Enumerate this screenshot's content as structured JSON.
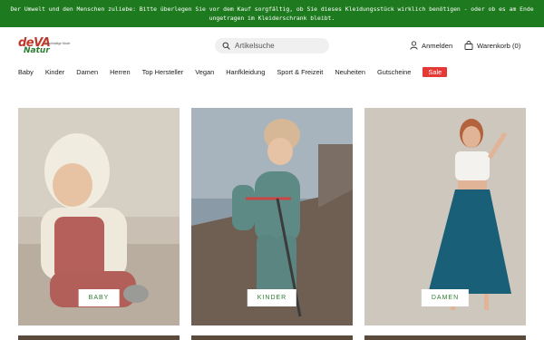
{
  "announcement": {
    "line1": "Der Umwelt und den Menschen zuliebe: Bitte überlegen Sie vor dem Kauf sorgfältig, ob Sie dieses Kleidungsstück wirklich benötigen - oder ob es am Ende",
    "line2": "ungetragen im Kleiderschrank bleibt."
  },
  "logo": {
    "deva": "deVA",
    "natur": "Natur",
    "tagline": "Nachhaltige Mode"
  },
  "search": {
    "placeholder": "Artikelsuche",
    "icon": "search-icon"
  },
  "account": {
    "label": "Anmelden",
    "icon": "user-icon"
  },
  "cart": {
    "label": "Warenkorb (0)",
    "icon": "bag-icon"
  },
  "nav": {
    "items": [
      "Baby",
      "Kinder",
      "Damen",
      "Herren",
      "Top Hersteller",
      "Vegan",
      "Hanfkleidung",
      "Sport & Freizeit",
      "Neuheiten",
      "Gutscheine"
    ],
    "sale": "Sale"
  },
  "categories": [
    {
      "label": "BABY"
    },
    {
      "label": "KINDER"
    },
    {
      "label": "DAMEN"
    }
  ],
  "colors": {
    "announcement_bg": "#1e7a1e",
    "label_text": "#2e7d32",
    "sale_bg": "#e53935"
  }
}
